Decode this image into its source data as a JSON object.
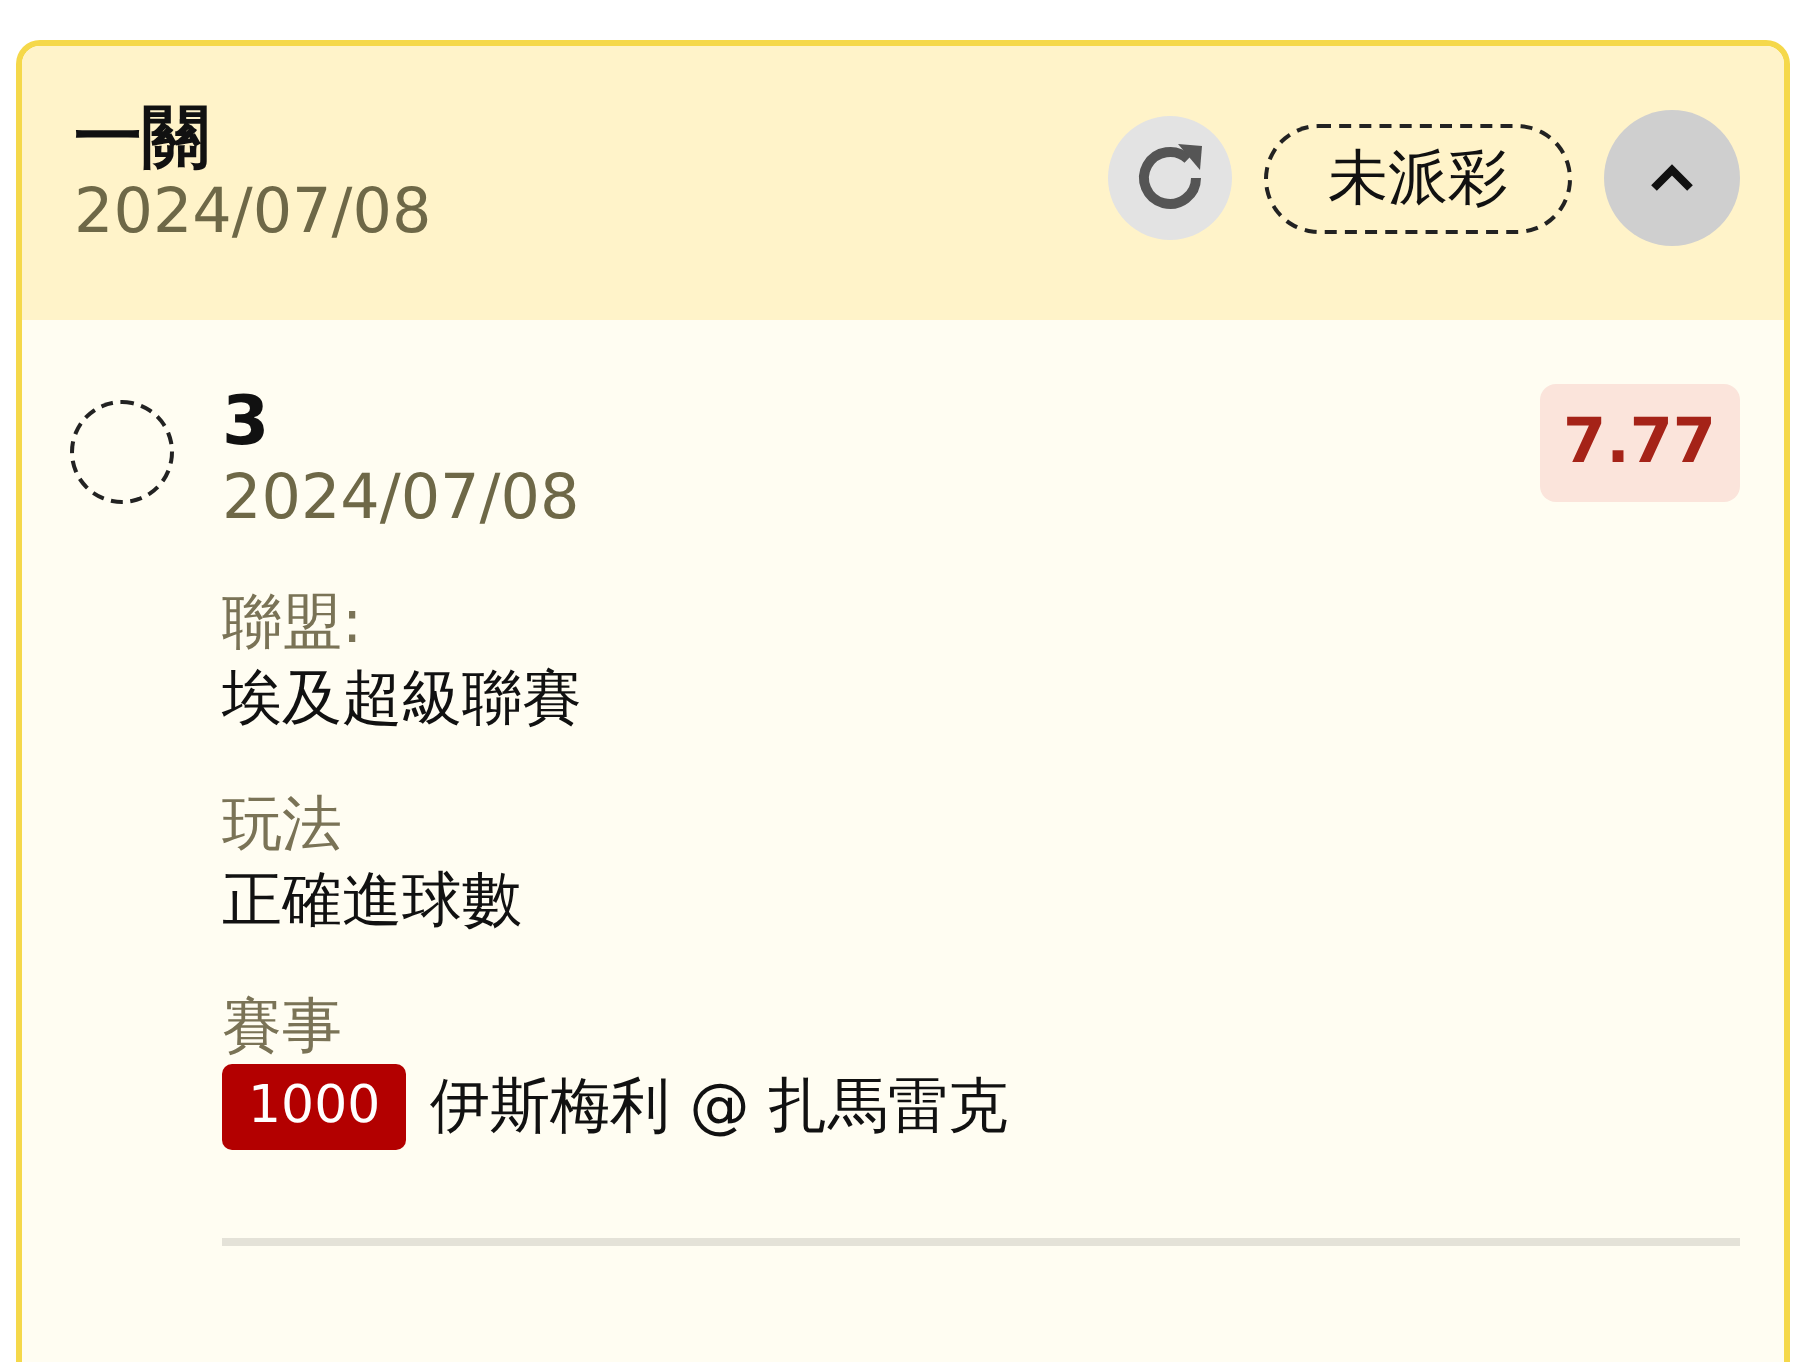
{
  "card": {
    "title": "一關",
    "date": "2024/07/08",
    "status": "未派彩",
    "expanded": true
  },
  "selection": {
    "title": "3",
    "date": "2024/07/08",
    "selected": false,
    "odds": "7.77",
    "details": [
      {
        "kind": "text",
        "label": "聯盟:",
        "value": "埃及超級聯賽"
      },
      {
        "kind": "text",
        "label": "玩法",
        "value": "正確進球數"
      },
      {
        "kind": "match",
        "label": "賽事",
        "number": "1000",
        "value": "伊斯梅利 @ 扎馬雷克"
      }
    ]
  }
}
